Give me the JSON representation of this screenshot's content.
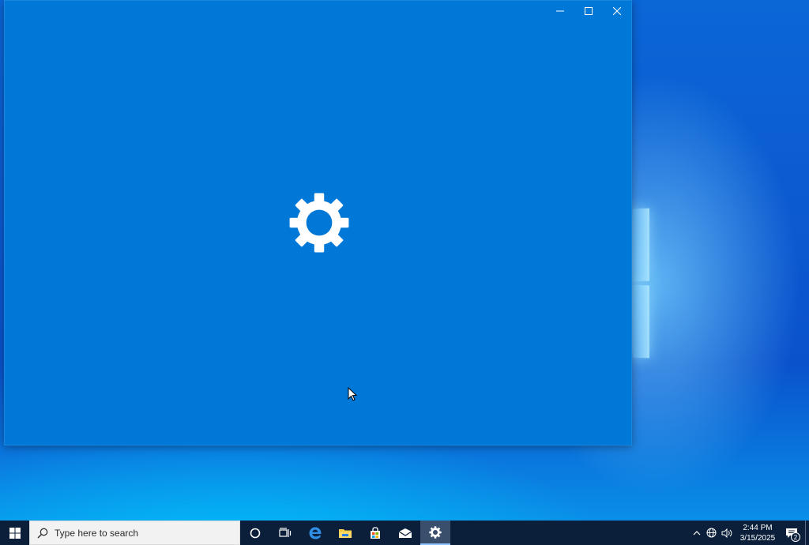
{
  "window": {
    "caption": {
      "minimize_icon": "minimize-icon",
      "maximize_icon": "maximize-icon",
      "close_icon": "close-icon"
    },
    "splash_icon": "gear-icon",
    "background_color": "#0078d7"
  },
  "taskbar": {
    "search": {
      "placeholder": "Type here to search"
    },
    "pinned": [
      {
        "name": "cortana-icon"
      },
      {
        "name": "task-view-icon"
      },
      {
        "name": "edge-icon"
      },
      {
        "name": "file-explorer-icon"
      },
      {
        "name": "store-icon"
      },
      {
        "name": "mail-icon"
      },
      {
        "name": "settings-icon",
        "active": true
      }
    ],
    "tray": {
      "clock_time": "2:44 PM",
      "clock_date": "3/15/2025",
      "notification_count": "2"
    }
  },
  "colors": {
    "accent": "#0078d7",
    "taskbar": "#0b1f3a"
  }
}
